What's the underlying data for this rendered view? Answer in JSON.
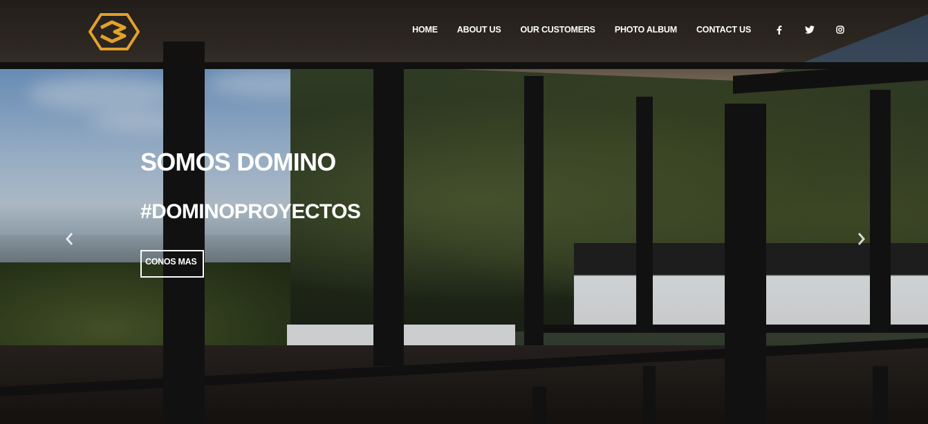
{
  "brand": {
    "logo_icon": "domino-hexagon-logo-icon",
    "accent_color": "#E2A12B"
  },
  "nav": {
    "items": [
      {
        "label": "HOME"
      },
      {
        "label": "ABOUT US"
      },
      {
        "label": "OUR CUSTOMERS"
      },
      {
        "label": "PHOTO ALBUM"
      },
      {
        "label": "CONTACT US"
      }
    ],
    "social": [
      {
        "icon": "facebook-icon"
      },
      {
        "icon": "twitter-icon"
      },
      {
        "icon": "instagram-icon"
      }
    ]
  },
  "hero": {
    "title": "SOMOS DOMINO",
    "subtitle": "#DOMINOPROYECTOS",
    "cta_label": "CONOS MAS",
    "prev_icon": "chevron-left-icon",
    "next_icon": "chevron-right-icon"
  },
  "colors": {
    "text": "#FFFFFF",
    "header_overlay": "#141210"
  }
}
